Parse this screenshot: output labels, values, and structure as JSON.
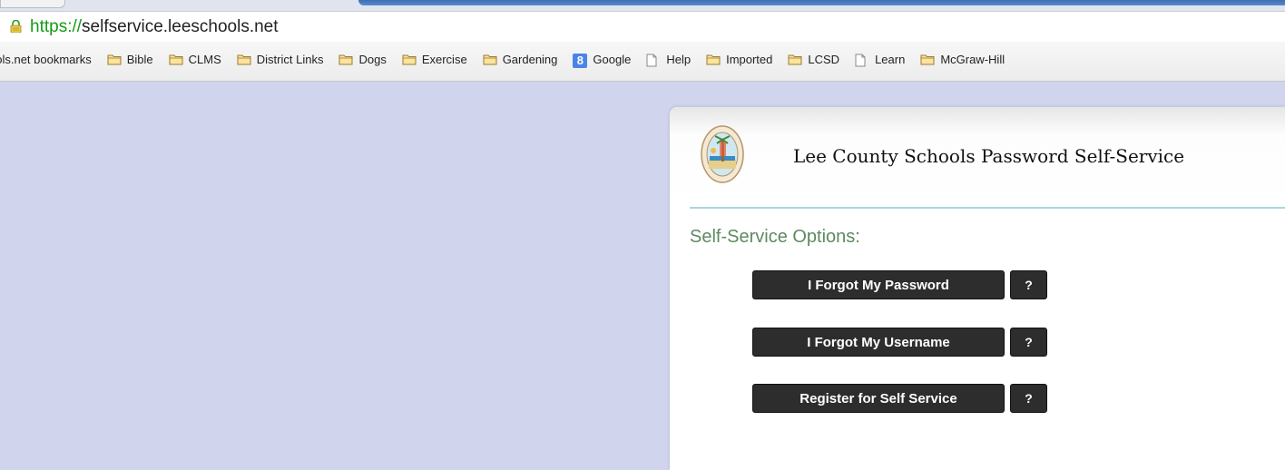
{
  "browser": {
    "url_protocol": "https://",
    "url_host": "selfservice.leeschools.net",
    "bookmarks": [
      {
        "label": "ools.net bookmarks",
        "icon": "none"
      },
      {
        "label": "Bible",
        "icon": "folder-icon"
      },
      {
        "label": "CLMS",
        "icon": "folder-icon"
      },
      {
        "label": "District Links",
        "icon": "folder-icon"
      },
      {
        "label": "Dogs",
        "icon": "folder-icon"
      },
      {
        "label": "Exercise",
        "icon": "folder-icon"
      },
      {
        "label": "Gardening",
        "icon": "folder-icon"
      },
      {
        "label": "Google",
        "icon": "google-icon"
      },
      {
        "label": "Help",
        "icon": "page-icon"
      },
      {
        "label": "Imported",
        "icon": "folder-icon"
      },
      {
        "label": "LCSD",
        "icon": "folder-icon"
      },
      {
        "label": "Learn",
        "icon": "page-icon"
      },
      {
        "label": "McGraw-Hill",
        "icon": "folder-icon"
      }
    ],
    "google_glyph": "8"
  },
  "page": {
    "title": "Lee County Schools Password Self-Service",
    "logo": "school-district-seal-icon",
    "options_heading": "Self-Service Options:",
    "options": [
      {
        "label": "I Forgot My Password",
        "help_label": "?"
      },
      {
        "label": "I Forgot My Username",
        "help_label": "?"
      },
      {
        "label": "Register for Self Service",
        "help_label": "?"
      }
    ]
  },
  "colors": {
    "background": "#d0d4ec",
    "button": "#2d2d2d",
    "heading_green": "#5e8a60",
    "rule": "#a8d7e0",
    "url_green": "#149a14"
  }
}
